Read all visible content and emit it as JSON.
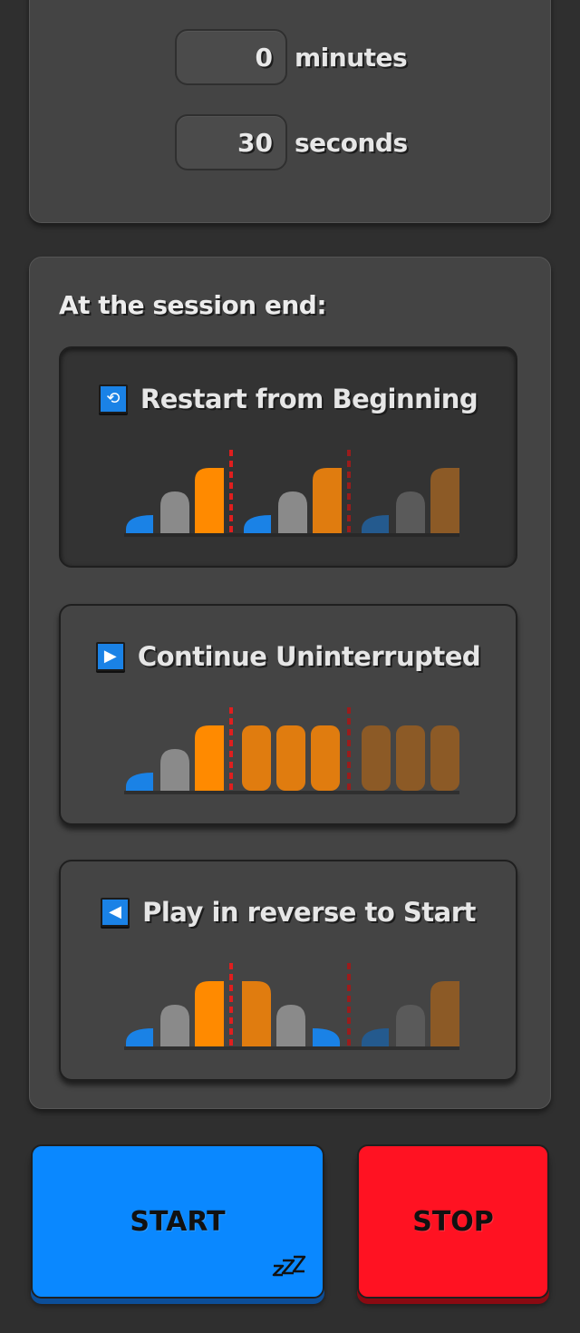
{
  "timer": {
    "minutes_value": "0",
    "minutes_label": "minutes",
    "seconds_value": "30",
    "seconds_label": "seconds"
  },
  "session_end": {
    "title": "At the session end:",
    "options": [
      {
        "label": "Restart from Beginning",
        "icon": "repeat-icon",
        "glyph": "⟲",
        "selected": true
      },
      {
        "label": "Continue Uninterrupted",
        "icon": "play-icon",
        "glyph": "▶",
        "selected": false
      },
      {
        "label": "Play in reverse to Start",
        "icon": "reverse-icon",
        "glyph": "◀",
        "selected": false
      }
    ]
  },
  "controls": {
    "start_label": "START",
    "stop_label": "STOP",
    "sleep_icon": "sleep-zzz-icon"
  },
  "colors": {
    "blue": "#1a82e6",
    "gray": "#8a8a8a",
    "orange": "#ff8a00",
    "start": "#0a88ff",
    "stop": "#ff1222",
    "divider": "#e01e1e"
  }
}
